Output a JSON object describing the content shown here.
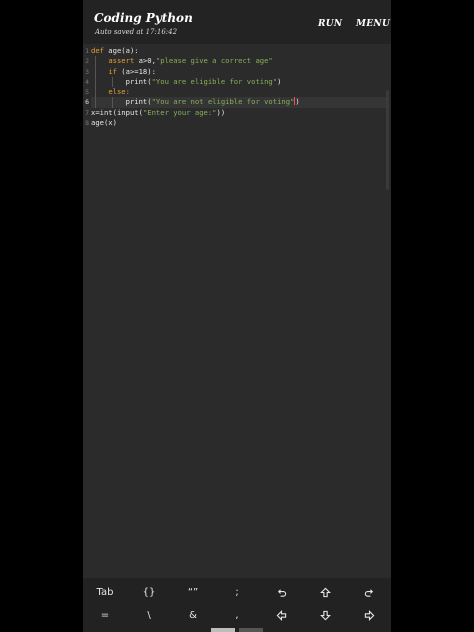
{
  "app": {
    "title": "Coding Python",
    "autosave": "Auto saved at 17:16:42",
    "run_label": "RUN",
    "menu_label": "MENU"
  },
  "editor": {
    "line_numbers": [
      "1",
      "2",
      "3",
      "4",
      "5",
      "6",
      "7",
      "8"
    ],
    "active_line": "6",
    "lines": {
      "l1": {
        "kw": "def",
        "rest": " age(a):"
      },
      "l2": {
        "kw": "assert",
        "mid": " a>0,",
        "str": "\"please give a correct age\""
      },
      "l3": {
        "kw": "if",
        "rest": " (a>=18):"
      },
      "l4": {
        "fn": "print(",
        "str": "\"You are eligible for voting\"",
        "end": ")"
      },
      "l5": {
        "kw": "else:"
      },
      "l6": {
        "fn": "print(",
        "str": "\"You are not eligible for voting\"",
        "end": ")"
      },
      "l7": {
        "a": "x=int(input(",
        "str": "\"Enter your age:\"",
        "end": "))"
      },
      "l8": {
        "a": "age(x)"
      }
    }
  },
  "keyboard": {
    "row1": [
      "Tab",
      "{}",
      "“”",
      ";",
      "undo-icon",
      "shift-up-icon",
      "redo-icon"
    ],
    "row1_text": {
      "tab": "Tab",
      "braces": "{}",
      "quotes": "“”",
      "semicolon": ";"
    },
    "row2_text": {
      "equals": "=",
      "backslash": "\\",
      "ampersand": "&",
      "comma": ","
    }
  },
  "colors": {
    "background": "#2b2b2b",
    "keyword": "#e0a030",
    "string": "#86b05a",
    "cursor": "#ff4a4a"
  }
}
